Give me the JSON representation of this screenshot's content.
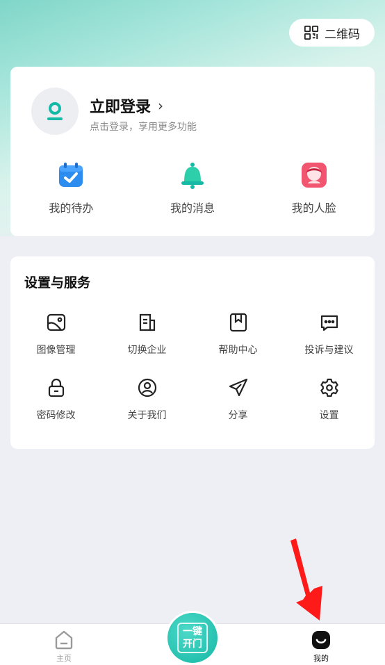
{
  "header": {
    "qr_label": "二维码"
  },
  "login": {
    "title": "立即登录",
    "subtitle": "点击登录，享用更多功能"
  },
  "quick": [
    {
      "label": "我的待办",
      "icon": "calendar-check-icon"
    },
    {
      "label": "我的消息",
      "icon": "bell-icon"
    },
    {
      "label": "我的人脸",
      "icon": "face-icon"
    }
  ],
  "services": {
    "title": "设置与服务",
    "items": [
      {
        "label": "图像管理",
        "icon": "image-icon"
      },
      {
        "label": "切换企业",
        "icon": "switch-company-icon"
      },
      {
        "label": "帮助中心",
        "icon": "help-book-icon"
      },
      {
        "label": "投诉与建议",
        "icon": "chat-dots-icon"
      },
      {
        "label": "密码修改",
        "icon": "lock-icon"
      },
      {
        "label": "关于我们",
        "icon": "user-circle-icon"
      },
      {
        "label": "分享",
        "icon": "paper-plane-icon"
      },
      {
        "label": "设置",
        "icon": "gear-icon"
      }
    ]
  },
  "tabbar": {
    "home_label": "主页",
    "open_label_line1": "一键",
    "open_label_line2": "开门",
    "mine_label": "我的"
  },
  "colors": {
    "accent": "#16b8a6",
    "arrow": "#ff1a1a"
  }
}
